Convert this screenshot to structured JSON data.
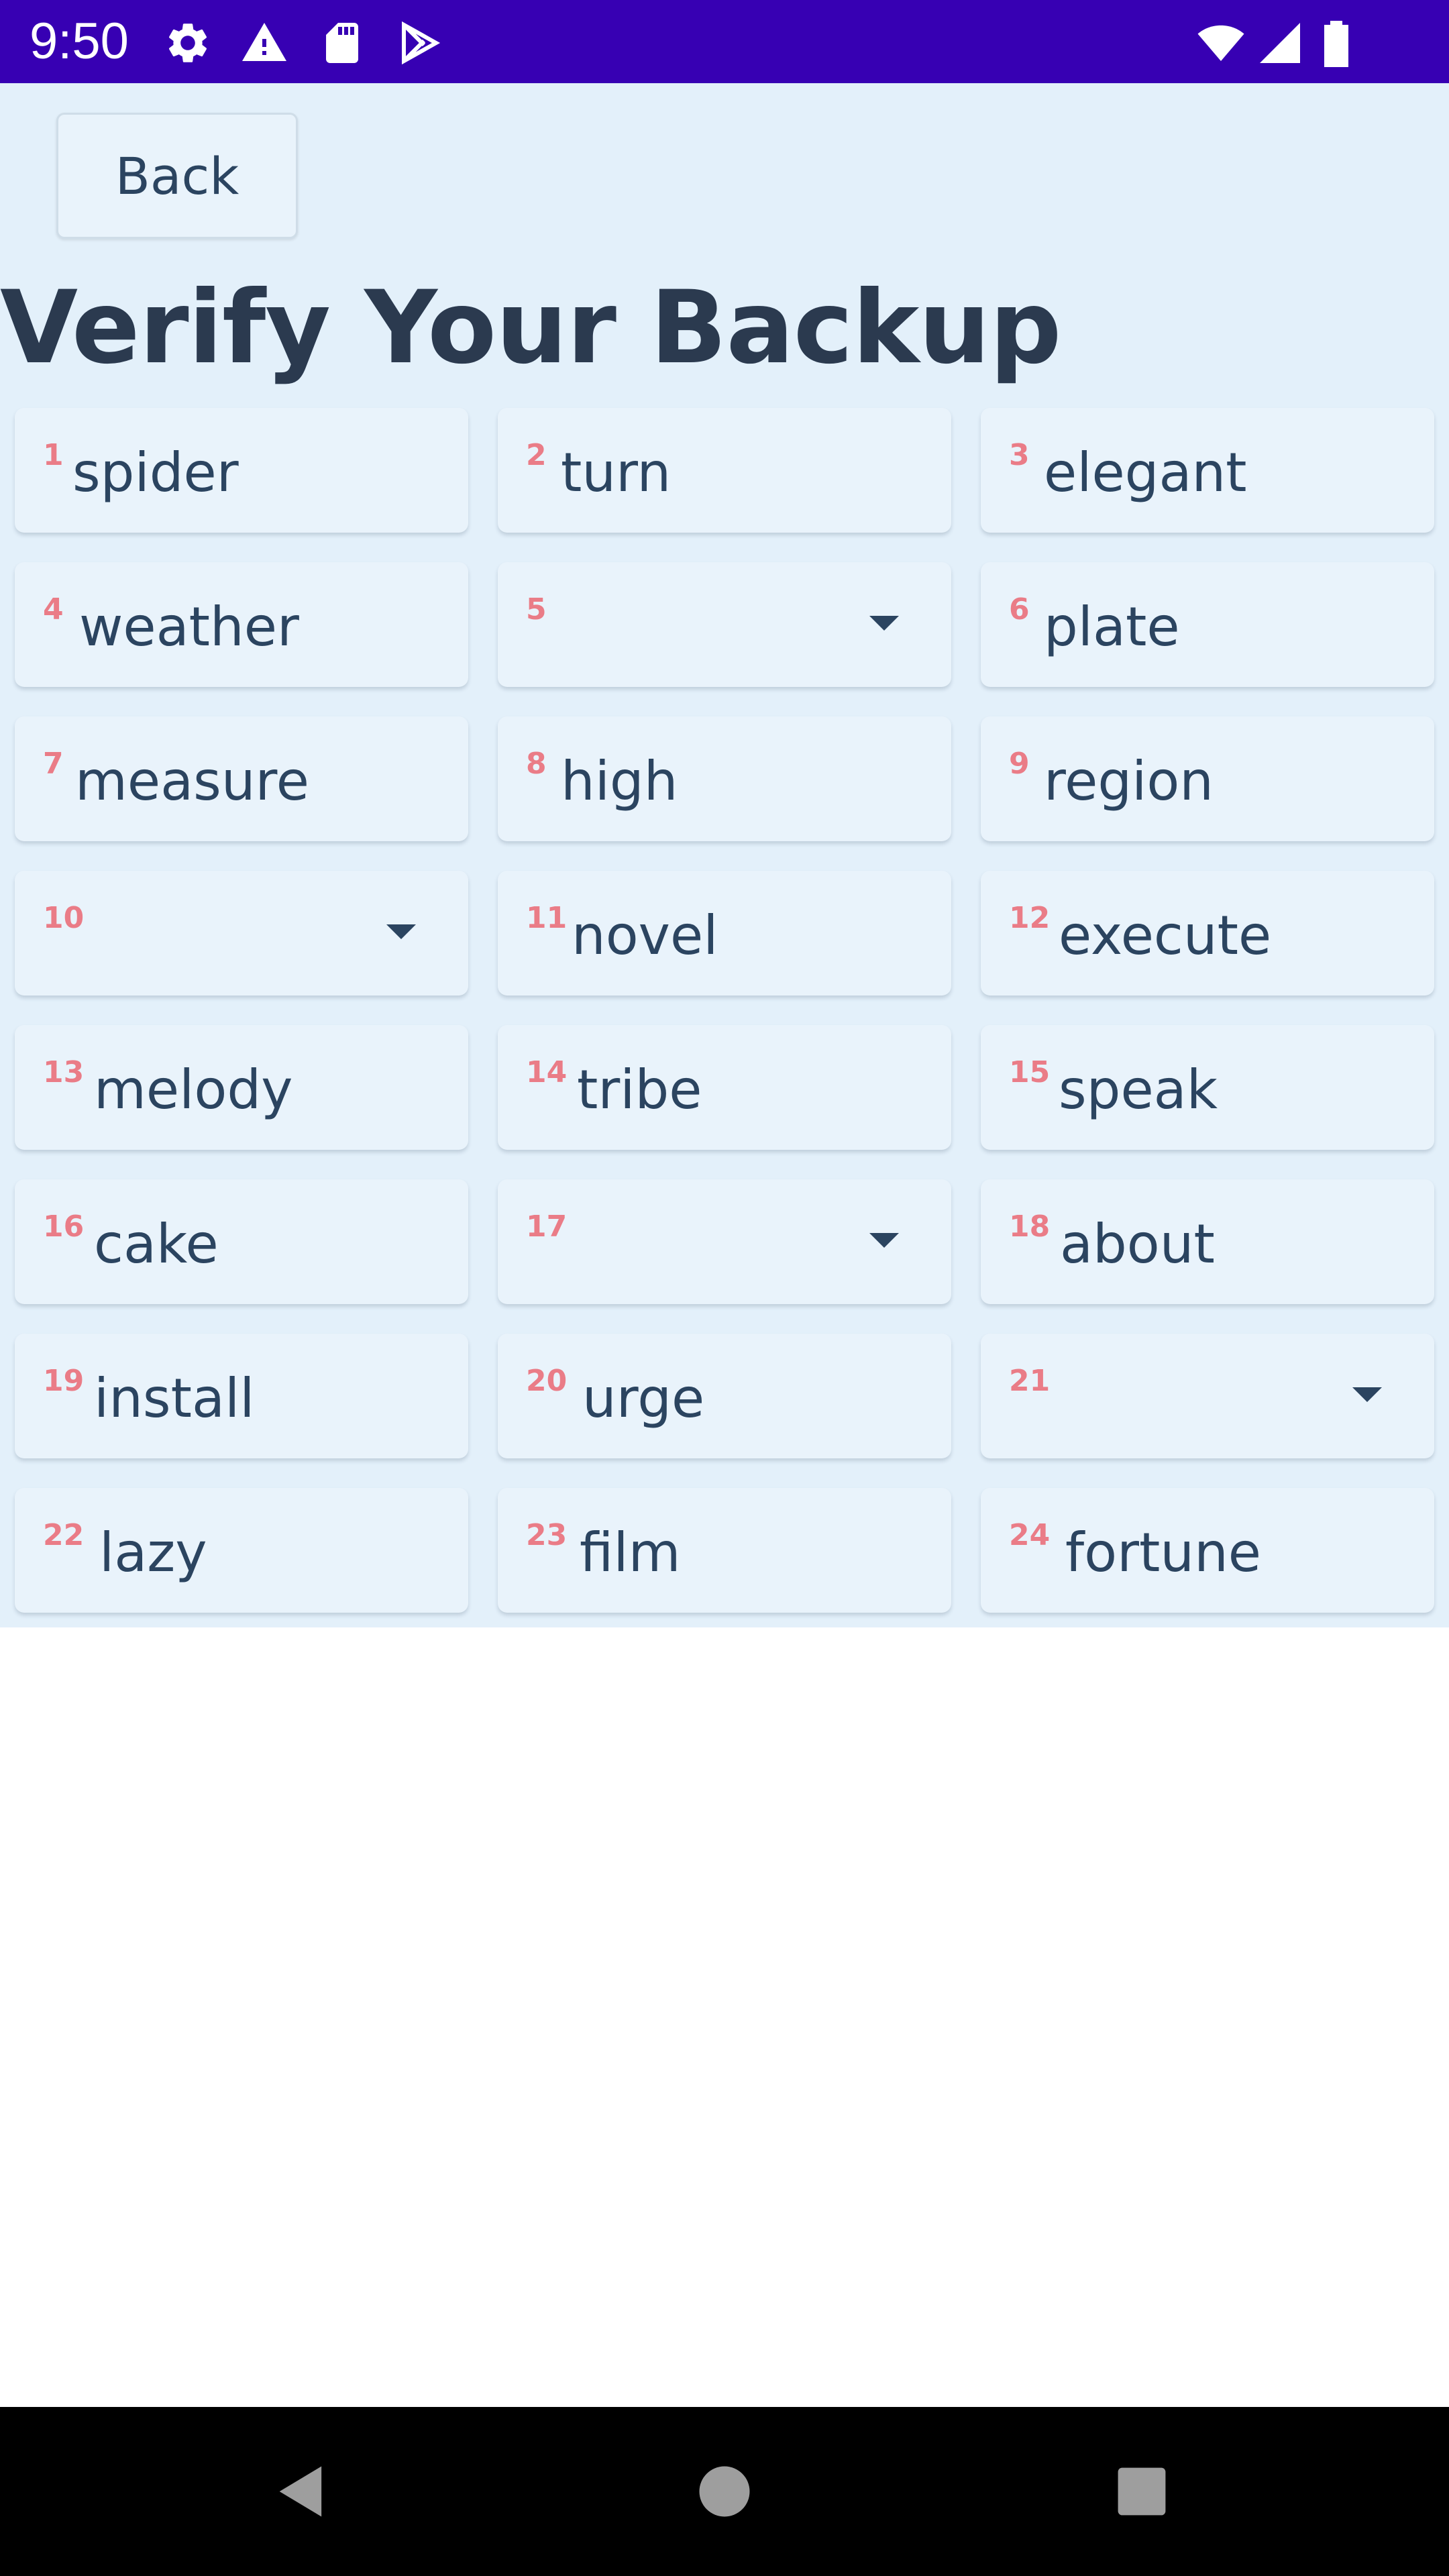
{
  "status_bar": {
    "time": "9:50",
    "left_icons": [
      "gear-icon",
      "warning-icon",
      "sd-card-icon",
      "play-store-icon"
    ],
    "right_icons": [
      "wifi-icon",
      "cellular-signal-icon",
      "battery-icon"
    ],
    "background_color": "#3700b3"
  },
  "header": {
    "back_label": "Back",
    "title": "Verify Your Backup"
  },
  "words": [
    {
      "number": "1",
      "word": "spider"
    },
    {
      "number": "2",
      "word": "turn"
    },
    {
      "number": "3",
      "word": "elegant"
    },
    {
      "number": "4",
      "word": "weather"
    },
    {
      "number": "5",
      "word": "",
      "dropdown": true
    },
    {
      "number": "6",
      "word": "plate"
    },
    {
      "number": "7",
      "word": "measure"
    },
    {
      "number": "8",
      "word": "high"
    },
    {
      "number": "9",
      "word": "region"
    },
    {
      "number": "10",
      "word": "",
      "dropdown": true
    },
    {
      "number": "11",
      "word": "novel"
    },
    {
      "number": "12",
      "word": "execute"
    },
    {
      "number": "13",
      "word": "melody"
    },
    {
      "number": "14",
      "word": "tribe"
    },
    {
      "number": "15",
      "word": "speak"
    },
    {
      "number": "16",
      "word": "cake"
    },
    {
      "number": "17",
      "word": "",
      "dropdown": true
    },
    {
      "number": "18",
      "word": "about"
    },
    {
      "number": "19",
      "word": "install"
    },
    {
      "number": "20",
      "word": "urge"
    },
    {
      "number": "21",
      "word": "",
      "dropdown": true
    },
    {
      "number": "22",
      "word": "lazy"
    },
    {
      "number": "23",
      "word": "film"
    },
    {
      "number": "24",
      "word": "fortune"
    }
  ],
  "nav_bar": {
    "buttons": [
      "back-triangle-icon",
      "home-circle-icon",
      "recents-square-icon"
    ]
  },
  "colors": {
    "accent": "#3700b3",
    "app_background": "#e3f0fa",
    "card_background": "#e9f3fb",
    "number_color": "#ea7c87",
    "text_color": "#2b4460"
  }
}
